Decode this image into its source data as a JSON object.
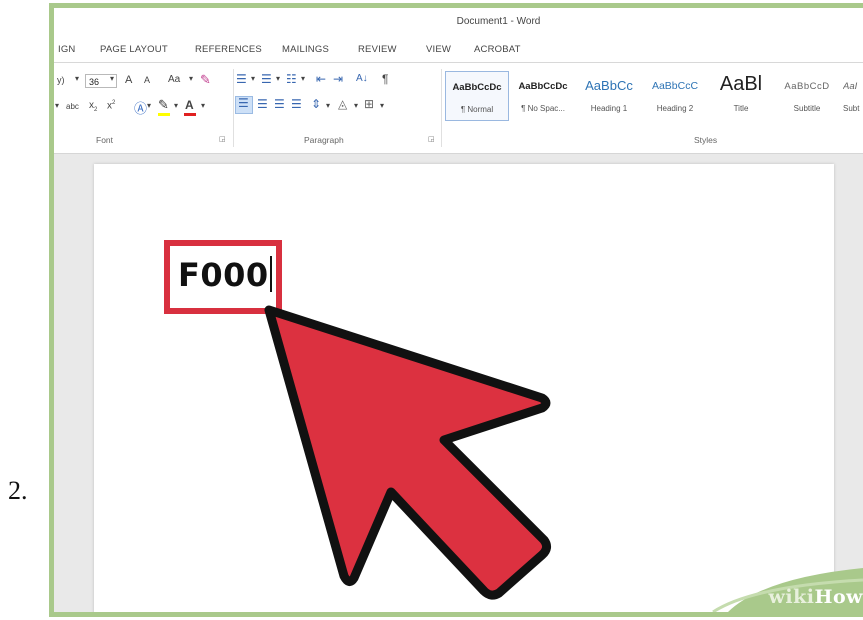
{
  "step": {
    "number": "2."
  },
  "window": {
    "title": "Document1 - Word"
  },
  "tabs": [
    "IGN",
    "PAGE LAYOUT",
    "REFERENCES",
    "MAILINGS",
    "REVIEW",
    "VIEW",
    "ACROBAT"
  ],
  "ribbon": {
    "font": {
      "font_name_tail": "y)",
      "font_size": "36",
      "grow_label": "A",
      "shrink_label": "A",
      "change_case_label": "Aa",
      "strikethrough_label": "abc",
      "subscript_label": "x",
      "superscript_label": "x",
      "font_color_label": "A",
      "group_label": "Font"
    },
    "paragraph": {
      "sort_label": "A↓",
      "pilcrow_label": "¶",
      "group_label": "Paragraph"
    },
    "styles": {
      "group_label": "Styles",
      "items": [
        {
          "preview": "AaBbCcDc",
          "name": "¶ Normal"
        },
        {
          "preview": "AaBbCcDc",
          "name": "¶ No Spac..."
        },
        {
          "preview": "AaBbCc",
          "name": "Heading 1"
        },
        {
          "preview": "AaBbCcC",
          "name": "Heading 2"
        },
        {
          "preview": "AaBl",
          "name": "Title"
        },
        {
          "preview": "AaBbCcD",
          "name": "Subtitle"
        },
        {
          "preview": "AaI",
          "name": "Subt"
        }
      ]
    }
  },
  "document": {
    "text": "F000"
  },
  "watermark": {
    "part1": "wiki",
    "part2": "How"
  },
  "colors": {
    "highlight": "#d8303f",
    "arrow_fill": "#dc3140",
    "frame": "#a9c98b",
    "heading_blue": "#2e74b5"
  }
}
